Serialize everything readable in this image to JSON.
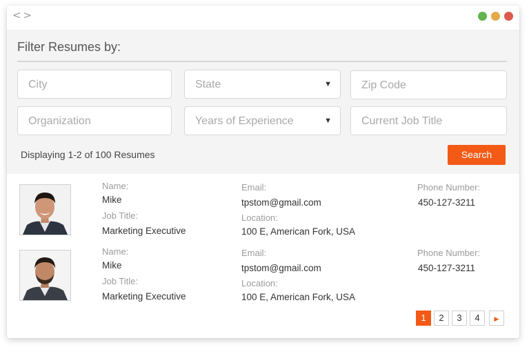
{
  "titlebar": {
    "code_icon": "< >",
    "window_controls": [
      {
        "name": "maximize",
        "color": "#62b34e"
      },
      {
        "name": "minimize",
        "color": "#e3aa48"
      },
      {
        "name": "close",
        "color": "#dd5a4e"
      }
    ]
  },
  "filter": {
    "title": "Filter Resumes by:",
    "fields": {
      "city": {
        "placeholder": "City"
      },
      "state": {
        "placeholder": "State",
        "type": "dropdown"
      },
      "zip": {
        "placeholder": "Zip Code"
      },
      "organization": {
        "placeholder": "Organization"
      },
      "years_experience": {
        "placeholder": "Years of Experience",
        "type": "dropdown"
      },
      "job_title": {
        "placeholder": "Current Job Title"
      }
    },
    "dropdown_arrow": "▼",
    "status": "Displaying 1-2 of 100 Resumes",
    "search_label": "Search",
    "accent_color": "#f25a16"
  },
  "labels": {
    "name": "Name:",
    "job_title": "Job Title:",
    "email": "Email:",
    "location": "Location:",
    "phone": "Phone Number:"
  },
  "resumes": [
    {
      "name": "Mike",
      "job_title": "Marketing Executive",
      "email": "tpstom@gmail.com",
      "location": "100 E, American Fork, USA",
      "phone": "450-127-3211",
      "photo": "smiling-man-photo"
    },
    {
      "name": "Mike",
      "job_title": "Marketing Executive",
      "email": "tpstom@gmail.com",
      "location": "100 E, American Fork, USA",
      "phone": "450-127-3211",
      "photo": "bearded-man-photo"
    }
  ],
  "pagination": {
    "pages": [
      "1",
      "2",
      "3",
      "4"
    ],
    "current": "1",
    "next_icon": "▶"
  }
}
